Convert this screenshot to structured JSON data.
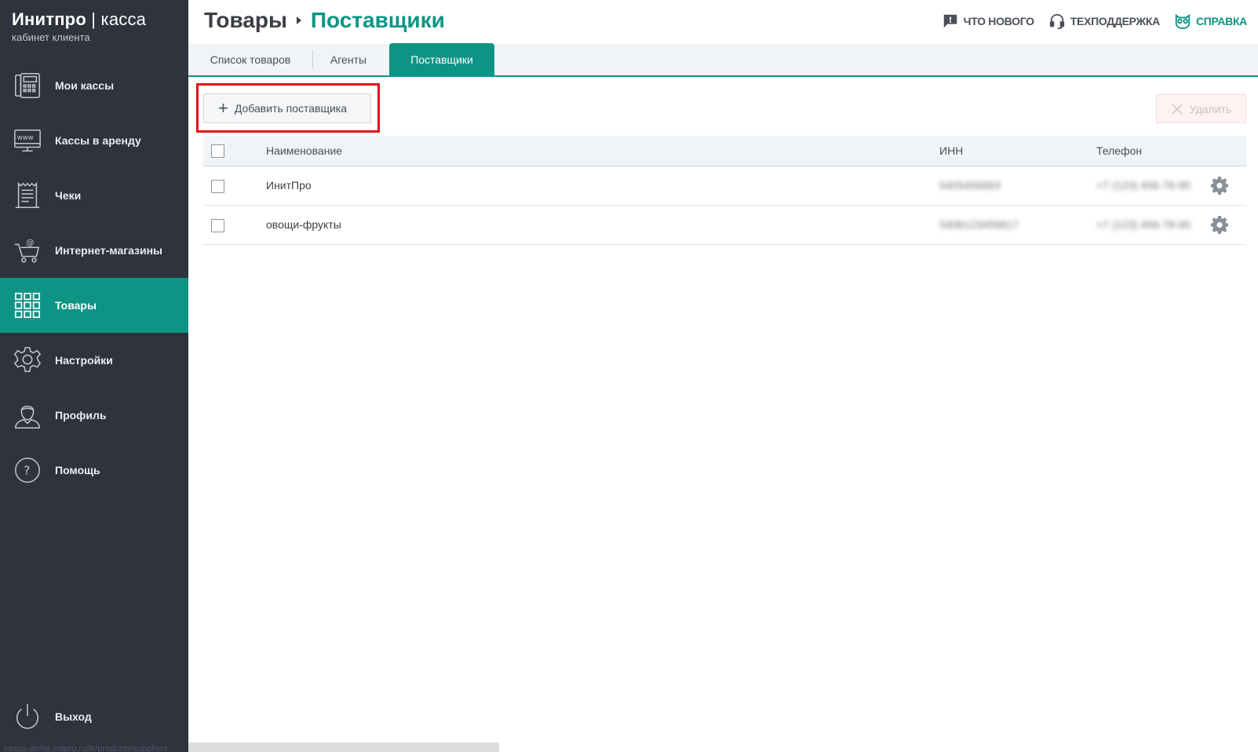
{
  "brand": {
    "name_bold": "Инитпро",
    "separator": "|",
    "name_thin": "касса",
    "subtitle": "кабинет клиента"
  },
  "sidebar": {
    "items": [
      {
        "label": "Мои кассы",
        "icon": "cash-register-icon"
      },
      {
        "label": "Кассы в аренду",
        "icon": "monitor-www-icon"
      },
      {
        "label": "Чеки",
        "icon": "receipt-icon"
      },
      {
        "label": "Интернет-магазины",
        "icon": "cart-at-icon"
      },
      {
        "label": "Товары",
        "icon": "grid-icon",
        "active": true
      },
      {
        "label": "Настройки",
        "icon": "gear-icon"
      },
      {
        "label": "Профиль",
        "icon": "user-icon"
      },
      {
        "label": "Помощь",
        "icon": "question-icon"
      }
    ],
    "logout_label": "Выход",
    "status_url": "kassa-aloha.initpro.ru/lk/products/suppliers"
  },
  "header": {
    "crumb_parent": "Товары",
    "crumb_current": "Поставщики",
    "links": {
      "whats_new": "ЧТО НОВОГО",
      "support": "ТЕХПОДДЕРЖКА",
      "help": "СПРАВКА"
    }
  },
  "tabs": [
    {
      "label": "Список товаров"
    },
    {
      "label": "Агенты"
    },
    {
      "label": "Поставщики",
      "active": true
    }
  ],
  "toolbar": {
    "add_label": "Добавить поставщика",
    "delete_label": "Удалить"
  },
  "table": {
    "columns": [
      "Наименование",
      "ИНН",
      "Телефон"
    ],
    "rows": [
      {
        "name": "ИнитПро",
        "inn": "5405456893",
        "phone": "+7 (123) 456-78-90"
      },
      {
        "name": "овощи-фрукты",
        "inn": "5406123456817",
        "phone": "+7 (123) 456-78-90"
      }
    ]
  },
  "colors": {
    "accent": "#0d9484",
    "sidebar_bg": "#2e333e",
    "highlight": "#e5131d"
  }
}
